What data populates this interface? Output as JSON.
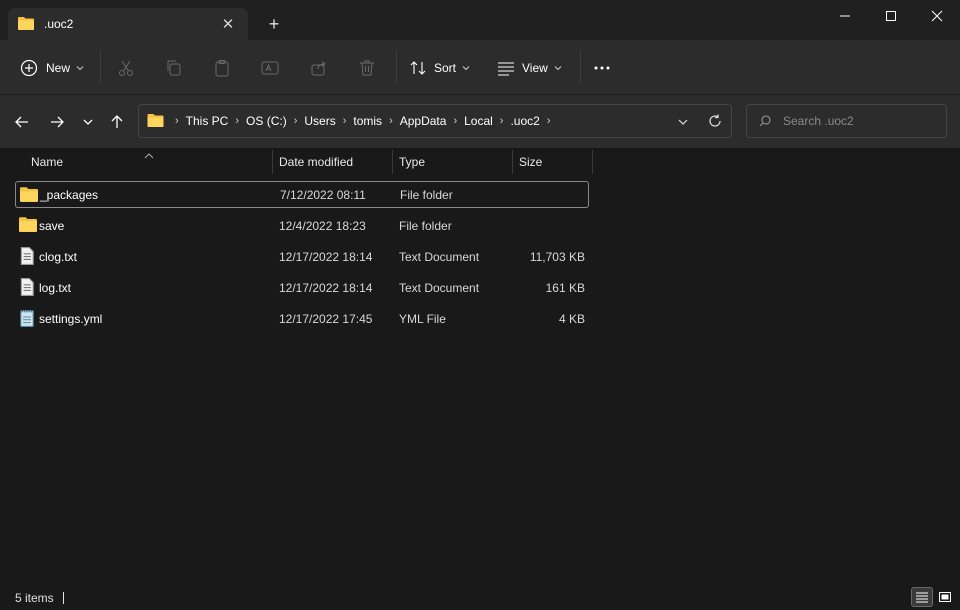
{
  "window": {
    "tab_title": ".uoc2",
    "controls": [
      "minimize",
      "maximize",
      "close"
    ]
  },
  "toolbar": {
    "new_label": "New",
    "sort_label": "Sort",
    "view_label": "View",
    "icons": [
      "cut-icon",
      "copy-icon",
      "paste-icon",
      "rename-icon",
      "share-icon",
      "delete-icon",
      "more-icon"
    ]
  },
  "address": {
    "crumbs": [
      "This PC",
      "OS (C:)",
      "Users",
      "tomis",
      "AppData",
      "Local",
      ".uoc2"
    ]
  },
  "search": {
    "placeholder": "Search .uoc2"
  },
  "columns": {
    "name": "Name",
    "date": "Date modified",
    "type": "Type",
    "size": "Size"
  },
  "files": [
    {
      "name": "_packages",
      "date": "7/12/2022 08:11",
      "type": "File folder",
      "size": "",
      "icon": "folder-icon"
    },
    {
      "name": "save",
      "date": "12/4/2022 18:23",
      "type": "File folder",
      "size": "",
      "icon": "folder-icon"
    },
    {
      "name": "clog.txt",
      "date": "12/17/2022 18:14",
      "type": "Text Document",
      "size": "11,703 KB",
      "icon": "text-file-icon"
    },
    {
      "name": "log.txt",
      "date": "12/17/2022 18:14",
      "type": "Text Document",
      "size": "161 KB",
      "icon": "text-file-icon"
    },
    {
      "name": "settings.yml",
      "date": "12/17/2022 17:45",
      "type": "YML File",
      "size": "4 KB",
      "icon": "yml-file-icon"
    }
  ],
  "status": {
    "item_count": "5 items"
  },
  "colors": {
    "folder": "#f5c242",
    "background": "#191919",
    "chrome": "#2c2c2c"
  }
}
